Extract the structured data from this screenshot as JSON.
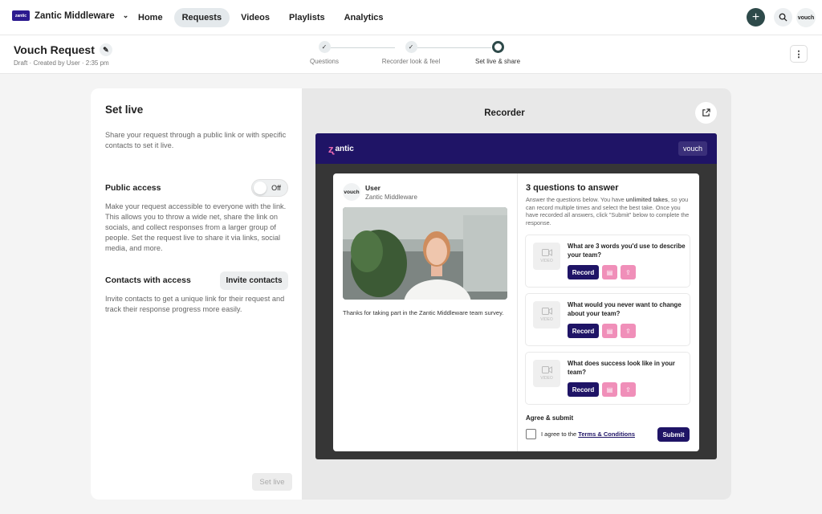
{
  "org": {
    "name": "Zantic Middleware",
    "logo_text": "zantic"
  },
  "nav": {
    "items": [
      "Home",
      "Requests",
      "Videos",
      "Playlists",
      "Analytics"
    ],
    "active": "Requests"
  },
  "user_avatar_text": "vouch",
  "header": {
    "title": "Vouch Request",
    "meta": "Draft · Created by User · 2:35 pm"
  },
  "steps": [
    {
      "label": "Questions",
      "state": "done"
    },
    {
      "label": "Recorder look & feel",
      "state": "done"
    },
    {
      "label": "Set live & share",
      "state": "current"
    }
  ],
  "left": {
    "title": "Set live",
    "intro": "Share your request through a public link or with specific contacts to set it live.",
    "public_access_title": "Public access",
    "toggle_label": "Off",
    "public_access_desc": "Make your request accessible to everyone with the link. This allows you to throw a wide net, share the link on socials, and collect responses from a larger group of people. Set the request live to share it via links, social media, and more.",
    "contacts_title": "Contacts with access",
    "invite_label": "Invite contacts",
    "contacts_desc": "Invite contacts to get a unique link for their request and track their response progress more easily.",
    "set_live_label": "Set live"
  },
  "recorder": {
    "title": "Recorder",
    "brand": "antic",
    "vouch_label": "vouch",
    "user_name": "User",
    "user_org": "Zantic Middleware",
    "avatar_text": "vouch",
    "thanks": "Thanks for taking part in the Zantic Middleware team survey.",
    "q_title": "3 questions to answer",
    "q_desc_pre": "Answer the questions below. You have ",
    "q_desc_bold": "unlimited takes",
    "q_desc_post": ", so you can record multiple times and select the best take. Once you have recorded all answers, click \"Submit\" below to complete the response.",
    "thumb_label": "VIDEO",
    "record_label": "Record",
    "questions": [
      "What are 3 words you'd use to describe your team?",
      "What would you never want to change about your team?",
      "What does success look like in your team?"
    ],
    "agree_title": "Agree & submit",
    "agree_pre": "I agree to the ",
    "terms": "Terms & Conditions",
    "submit_label": "Submit"
  },
  "colors": {
    "brand": "#1f1466",
    "accent_pink": "#f08fb9",
    "dark_button": "#2e4a4a"
  },
  "icons": [
    "chevron-down-icon",
    "plus-icon",
    "search-icon",
    "pencil-icon",
    "check-icon",
    "more-vertical-icon",
    "external-link-icon",
    "video-camera-icon",
    "notes-icon",
    "upload-icon"
  ]
}
